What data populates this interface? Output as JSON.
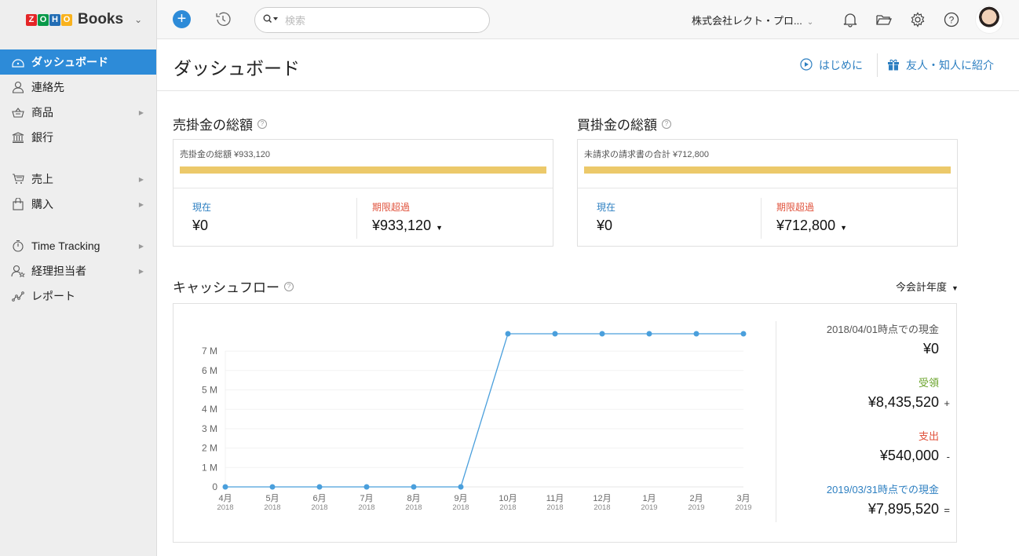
{
  "app": {
    "brand_letters": [
      "Z",
      "O",
      "H",
      "O"
    ],
    "brand_name": "Books"
  },
  "topbar": {
    "search_placeholder": "検索",
    "org_name": "株式会社レクト・プロ...",
    "icons": [
      "plus-icon",
      "history-icon",
      "bell-icon",
      "folder-icon",
      "gear-icon",
      "help-icon"
    ]
  },
  "sidebar": {
    "items": [
      {
        "label": "ダッシュボード",
        "icon": "dashboard-icon",
        "active": true
      },
      {
        "label": "連絡先",
        "icon": "contacts-icon"
      },
      {
        "label": "商品",
        "icon": "items-icon",
        "has_sub": true
      },
      {
        "label": "銀行",
        "icon": "bank-icon"
      },
      {
        "label": "売上",
        "icon": "cart-icon",
        "has_sub": true
      },
      {
        "label": "購入",
        "icon": "bag-icon",
        "has_sub": true
      },
      {
        "label": "Time Tracking",
        "icon": "stopwatch-icon",
        "has_sub": true
      },
      {
        "label": "経理担当者",
        "icon": "accountant-icon",
        "has_sub": true
      },
      {
        "label": "レポート",
        "icon": "reports-icon"
      }
    ]
  },
  "page": {
    "title": "ダッシュボード",
    "getting_started": "はじめに",
    "refer": "友人・知人に紹介"
  },
  "receivables": {
    "title": "売掛金の総額",
    "caption": "売掛金の総額 ¥933,120",
    "bar_fill_percent": 100,
    "current_label": "現在",
    "current_value": "¥0",
    "overdue_label": "期限超過",
    "overdue_value": "¥933,120"
  },
  "payables": {
    "title": "買掛金の総額",
    "caption": "未請求の請求書の合計 ¥712,800",
    "bar_fill_percent": 100,
    "current_label": "現在",
    "current_value": "¥0",
    "overdue_label": "期限超過",
    "overdue_value": "¥712,800"
  },
  "cashflow": {
    "title": "キャッシュフロー",
    "period": "今会計年度",
    "opening_label": "2018/04/01時点での現金",
    "opening_value": "¥0",
    "incoming_label": "受領",
    "incoming_value": "¥8,435,520",
    "incoming_op": "+",
    "outgoing_label": "支出",
    "outgoing_value": "¥540,000",
    "outgoing_op": "-",
    "closing_label": "2019/03/31時点での現金",
    "closing_value": "¥7,895,520",
    "closing_op": "="
  },
  "chart_data": {
    "type": "line",
    "title": "キャッシュフロー",
    "categories": [
      "4月|2018",
      "5月|2018",
      "6月|2018",
      "7月|2018",
      "8月|2018",
      "9月|2018",
      "10月|2018",
      "11月|2018",
      "12月|2018",
      "1月|2019",
      "2月|2019",
      "3月|2019"
    ],
    "series": [
      {
        "name": "現金",
        "values": [
          0,
          0,
          0,
          0,
          0,
          0,
          7895520,
          7895520,
          7895520,
          7895520,
          7895520,
          7895520
        ]
      }
    ],
    "yticks": [
      0,
      1000000,
      2000000,
      3000000,
      4000000,
      5000000,
      6000000,
      7000000
    ],
    "ytick_labels": [
      "0",
      "1 M",
      "2 M",
      "3 M",
      "4 M",
      "5 M",
      "6 M",
      "7 M"
    ],
    "ylim": [
      0,
      7895520
    ],
    "grid": true,
    "color": "#4a9fdc"
  }
}
